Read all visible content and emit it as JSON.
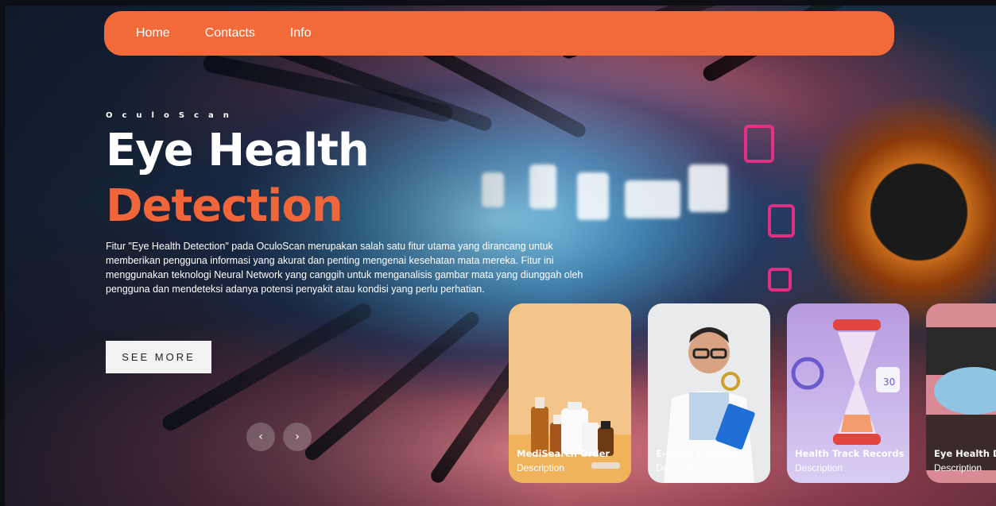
{
  "nav": {
    "items": [
      "Home",
      "Contacts",
      "Info"
    ]
  },
  "hero": {
    "brand": "OculoScan",
    "title_line1": "Eye Health",
    "title_line2": "Detection",
    "description": "Fitur \"Eye Health Detection\" pada OculoScan merupakan salah satu fitur utama yang dirancang untuk memberikan pengguna informasi yang akurat dan penting mengenai kesehatan mata mereka. Fitur ini menggunakan teknologi Neural Network yang canggih untuk menganalisis gambar mata yang diunggah oleh pengguna dan mendeteksi adanya potensi penyakit atau kondisi yang perlu perhatian.",
    "button_label": "SEE MORE"
  },
  "slider": {
    "prev_icon": "‹",
    "next_icon": "›"
  },
  "cards": [
    {
      "title": "MediSearch Order",
      "description": "Description"
    },
    {
      "title": "E-Clinic Connect",
      "description": "Description"
    },
    {
      "title": "Health Track Records",
      "description": "Description"
    },
    {
      "title": "Eye Health D",
      "description": "Description"
    }
  ],
  "colors": {
    "accent": "#f26a3a",
    "title_orange": "#f0653a"
  }
}
